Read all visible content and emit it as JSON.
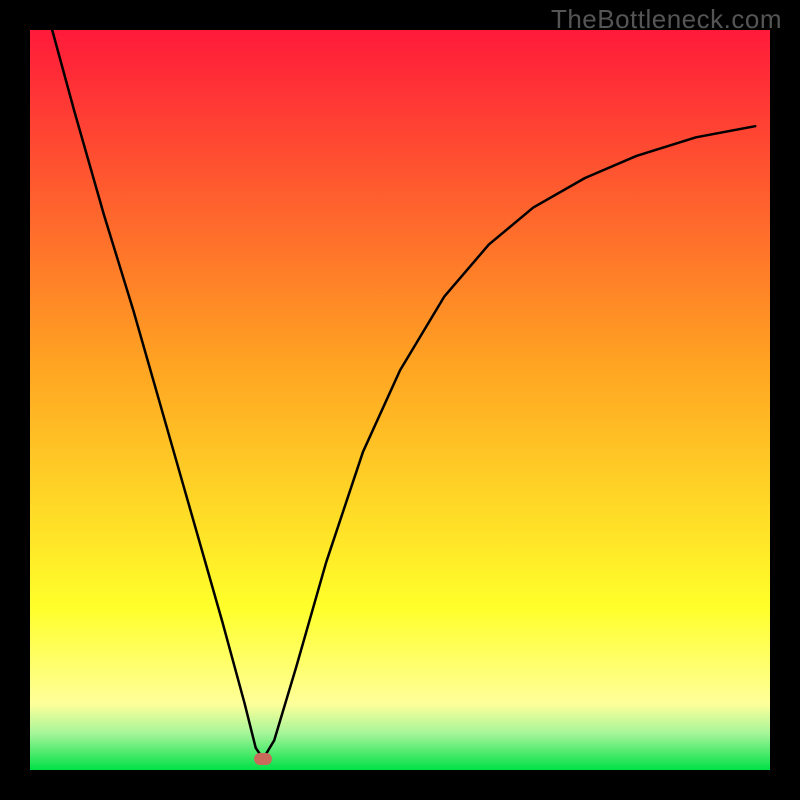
{
  "watermark": "TheBottleneck.com",
  "colors": {
    "red_top": "#ff1a3a",
    "orange": "#ffa322",
    "yellow": "#ffff2a",
    "yellow_pale": "#ffff9a",
    "green_band_top": "#a7f59a",
    "green_bottom": "#00e146",
    "curve": "#000000",
    "marker": "#c96b5a",
    "frame": "#000000"
  },
  "chart_data": {
    "type": "line",
    "title": "",
    "xlabel": "",
    "ylabel": "",
    "xlim": [
      0,
      100
    ],
    "ylim": [
      0,
      100
    ],
    "series": [
      {
        "name": "bottleneck-curve",
        "x": [
          3,
          6,
          10,
          14,
          18,
          22,
          26,
          29,
          30.5,
          31.5,
          33,
          36,
          40,
          45,
          50,
          56,
          62,
          68,
          75,
          82,
          90,
          98
        ],
        "y": [
          100,
          89,
          75,
          62,
          48,
          34,
          20,
          9,
          3,
          1.5,
          4,
          14,
          28,
          43,
          54,
          64,
          71,
          76,
          80,
          83,
          85.5,
          87
        ]
      }
    ],
    "annotations": [
      {
        "name": "minimum-marker",
        "x": 31.5,
        "y": 1.5
      }
    ],
    "gradient_bands": [
      {
        "at_y": 100,
        "color": "#ff1a3a"
      },
      {
        "at_y": 55,
        "color": "#ffa322"
      },
      {
        "at_y": 22,
        "color": "#ffff2a"
      },
      {
        "at_y": 9,
        "color": "#ffff9a"
      },
      {
        "at_y": 5,
        "color": "#a7f59a"
      },
      {
        "at_y": 0,
        "color": "#00e146"
      }
    ]
  }
}
